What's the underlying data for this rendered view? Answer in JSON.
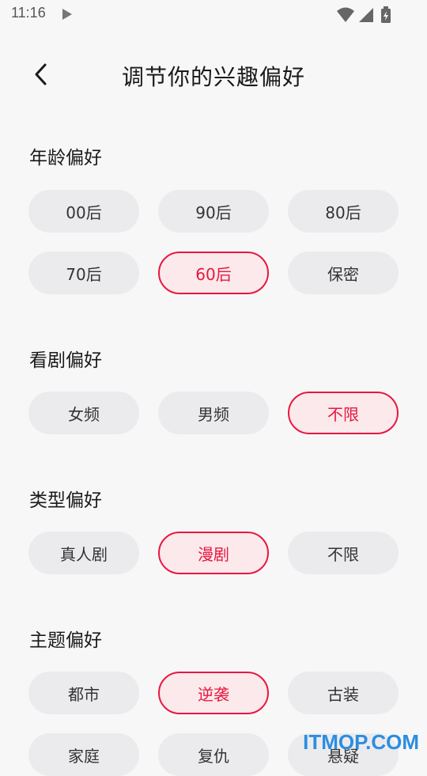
{
  "status_bar": {
    "time": "11:16"
  },
  "header": {
    "title": "调节你的兴趣偏好"
  },
  "sections": {
    "age": {
      "title": "年龄偏好",
      "options": [
        "00后",
        "90后",
        "80后",
        "70后",
        "60后",
        "保密"
      ],
      "selected": "60后"
    },
    "drama": {
      "title": "看剧偏好",
      "options": [
        "女频",
        "男频",
        "不限"
      ],
      "selected": "不限"
    },
    "genre": {
      "title": "类型偏好",
      "options": [
        "真人剧",
        "漫剧",
        "不限"
      ],
      "selected": "漫剧"
    },
    "theme": {
      "title": "主题偏好",
      "options": [
        "都市",
        "逆袭",
        "古装",
        "家庭",
        "复仇",
        "悬疑"
      ],
      "selected": "逆袭"
    }
  },
  "watermark": "ITMOP.COM",
  "colors": {
    "accent": "#e8173f",
    "chip_bg": "#ebebed",
    "selected_bg": "#fbe9ec",
    "page_bg": "#f7f7f7"
  }
}
